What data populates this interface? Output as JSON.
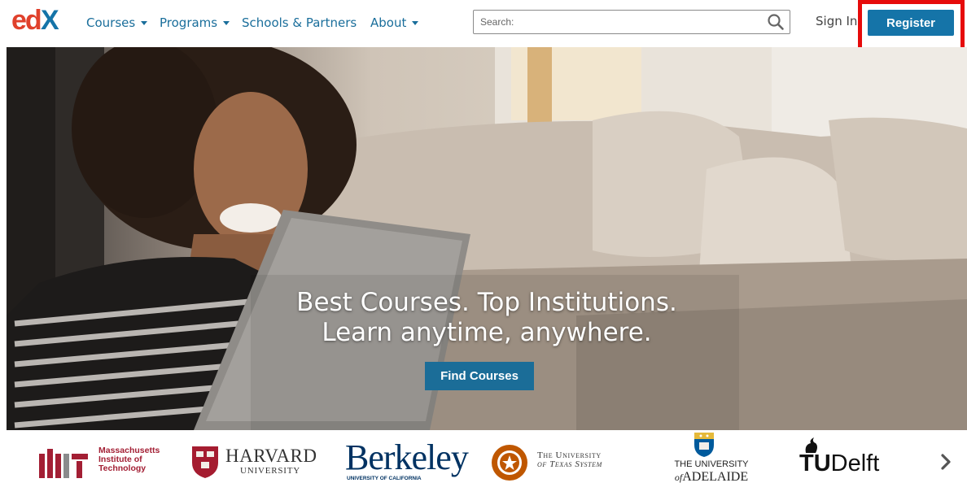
{
  "header": {
    "logo_text": "edX",
    "nav": [
      {
        "label": "Courses",
        "has_caret": true
      },
      {
        "label": "Programs",
        "has_caret": true
      },
      {
        "label": "Schools & Partners",
        "has_caret": false
      },
      {
        "label": "About",
        "has_caret": true
      }
    ],
    "search": {
      "placeholder": "Search:",
      "value": ""
    },
    "sign_in": "Sign In",
    "register": "Register"
  },
  "hero": {
    "line1": "Best Courses. Top Institutions.",
    "line2": "Learn anytime, anywhere.",
    "cta": "Find Courses"
  },
  "partners": {
    "mit": {
      "line1": "Massachusetts",
      "line2": "Institute of",
      "line3": "Technology"
    },
    "harvard": {
      "line1": "HARVARD",
      "line2": "UNIVERSITY"
    },
    "berkeley": {
      "line1": "Berkeley",
      "line2": "UNIVERSITY OF CALIFORNIA"
    },
    "texas": {
      "line1": "The University",
      "line2": "of Texas System"
    },
    "adelaide": {
      "line1": "THE UNIVERSITY",
      "line2_prefix": "of",
      "line2": "ADELAIDE"
    },
    "delft": {
      "line1": "TU",
      "line2": "Delft"
    }
  },
  "colors": {
    "brand_blue": "#1574a8",
    "nav_link": "#1a6e9b",
    "highlight_red": "#e60b0b",
    "mit_red": "#a31f34",
    "harvard_crimson": "#a51c30",
    "berkeley_blue": "#003262"
  }
}
